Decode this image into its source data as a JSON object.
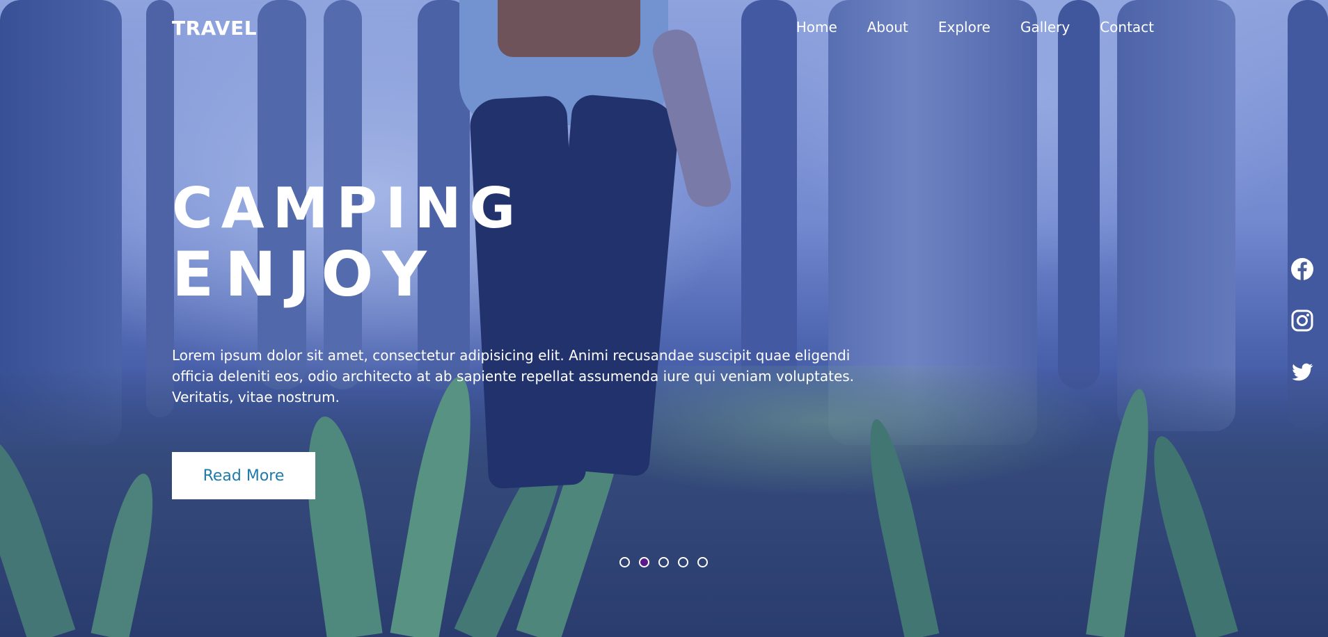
{
  "header": {
    "logo": "TRAVEL",
    "nav": [
      {
        "label": "Home"
      },
      {
        "label": "About"
      },
      {
        "label": "Explore"
      },
      {
        "label": "Gallery"
      },
      {
        "label": "Contact"
      }
    ]
  },
  "hero": {
    "title_line1": "CAMPING",
    "title_line2": "ENJOY",
    "description": "Lorem ipsum dolor sit amet, consectetur adipisicing elit. Animi recusandae suscipit quae eligendi officia deleniti eos, odio architecto at ab sapiente repellat assumenda iure qui veniam voluptates. Veritatis, vitae nostrum.",
    "button_label": "Read More"
  },
  "social": [
    "facebook-icon",
    "instagram-icon",
    "twitter-icon"
  ],
  "slider": {
    "dot_count": 5,
    "active_index": 1
  },
  "colors": {
    "button_text": "#1e7aa6",
    "active_dot": "#5b1a8c",
    "overlay": "#2846aa"
  }
}
